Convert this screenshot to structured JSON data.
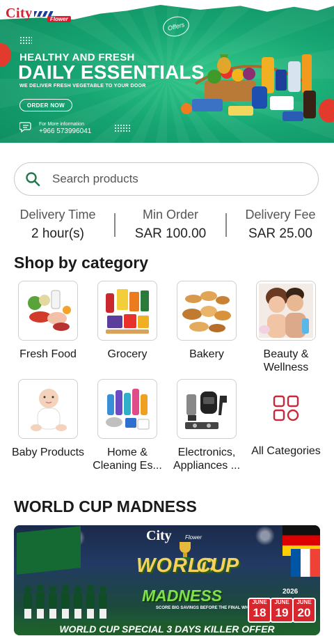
{
  "hero": {
    "logo": "City",
    "logo_sub": "Flower",
    "offers_badge": "Offers",
    "headline_small": "HEALTHY AND FRESH",
    "headline_big": "DAILY ESSENTIALS",
    "tagline": "WE DELIVER FRESH VEGETABLE TO YOUR DOOR",
    "order_button": "ORDER NOW",
    "info_label": "For More information",
    "phone": "+966 573996041"
  },
  "search": {
    "placeholder": "Search products"
  },
  "delivery": [
    {
      "label": "Delivery Time",
      "value": "2 hour(s)"
    },
    {
      "label": "Min Order",
      "value": "SAR 100.00"
    },
    {
      "label": "Delivery Fee",
      "value": "SAR 25.00"
    }
  ],
  "shop_by_category": {
    "title": "Shop by category",
    "items": [
      {
        "name": "Fresh Food",
        "icon": "fresh-food-image"
      },
      {
        "name": "Grocery",
        "icon": "grocery-image"
      },
      {
        "name": "Bakery",
        "icon": "bakery-image"
      },
      {
        "name": "Beauty & Wellness",
        "icon": "beauty-image"
      },
      {
        "name": "Baby Products",
        "icon": "baby-image"
      },
      {
        "name": "Home & Cleaning Es...",
        "icon": "home-cleaning-image"
      },
      {
        "name": "Electronics, Appliances ...",
        "icon": "electronics-image"
      },
      {
        "name": "All Categories",
        "icon": "grid-icon"
      }
    ]
  },
  "world_cup": {
    "title": "WORLD CUP MADNESS",
    "banner": {
      "brand": "City",
      "brand_sub": "Flower",
      "word1": "WORLD",
      "word2": "CUP",
      "word3": "MADNESS",
      "tagline": "SCORE BIG SAVINGS BEFORE THE FINAL WHISTLE!",
      "year": "2026",
      "dates": [
        {
          "month": "JUNE",
          "day": "18"
        },
        {
          "month": "JUNE",
          "day": "19"
        },
        {
          "month": "JUNE",
          "day": "20"
        }
      ],
      "strip": "WORLD CUP SPECIAL 3 DAYS KILLER OFFER"
    }
  },
  "colors": {
    "brand_red": "#d22030",
    "brand_blue": "#1c3f95",
    "hero_green": "#17a673",
    "accent_rose": "#c8283c"
  }
}
